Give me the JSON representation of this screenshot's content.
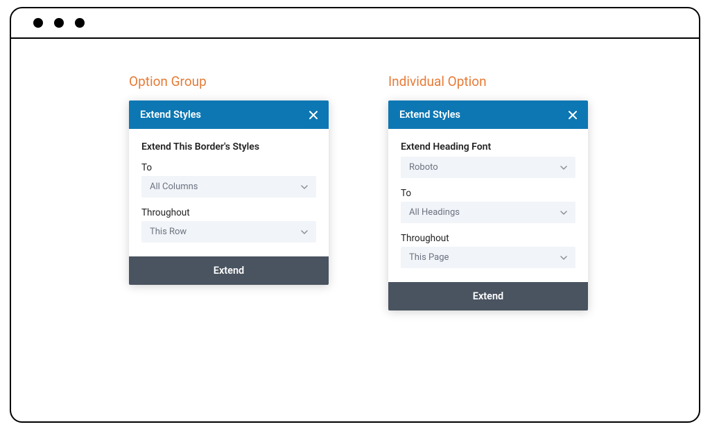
{
  "left": {
    "title": "Option Group",
    "card_title": "Extend Styles",
    "subtitle": "Extend This Border's Styles",
    "fields": [
      {
        "label": "To",
        "value": "All Columns"
      },
      {
        "label": "Throughout",
        "value": "This Row"
      }
    ],
    "button": "Extend"
  },
  "right": {
    "title": "Individual Option",
    "card_title": "Extend Styles",
    "subtitle": "Extend Heading Font",
    "font_value": "Roboto",
    "fields": [
      {
        "label": "To",
        "value": "All Headings"
      },
      {
        "label": "Throughout",
        "value": "This Page"
      }
    ],
    "button": "Extend"
  }
}
